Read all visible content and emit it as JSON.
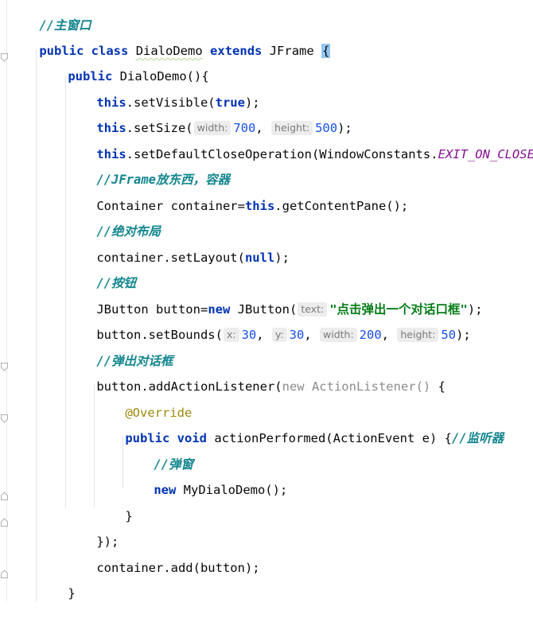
{
  "code": {
    "l1": {
      "comment": "//主窗口"
    },
    "l2": {
      "kw_public": "public",
      "kw_class": "class",
      "class_name": "DialoDemo",
      "kw_extends": "extends",
      "parent": "JFrame",
      "brace": "{"
    },
    "l3": {
      "kw_public": "public",
      "ctor": "DialoDemo(){"
    },
    "l4": {
      "kw_this": "this",
      "call": ".setVisible(",
      "kw_true": "true",
      "end": ");"
    },
    "l5": {
      "kw_this": "this",
      "call": ".setSize(",
      "hint_width": "width:",
      "width": "700",
      "comma": ",",
      "hint_height": "height:",
      "height": "500",
      "end": ");"
    },
    "l6": {
      "kw_this": "this",
      "call": ".setDefaultCloseOperation(WindowConstants.",
      "constant": "EXIT_ON_CLOSE",
      "end": ");"
    },
    "l7": {
      "comment": "//JFrame放东西，容器"
    },
    "l8": {
      "pre": "Container container=",
      "kw_this": "this",
      "post": ".getContentPane();"
    },
    "l9": {
      "comment": "//绝对布局"
    },
    "l10": {
      "pre": "container.setLayout(",
      "kw_null": "null",
      "end": ");"
    },
    "l11": {
      "comment": "//按钮"
    },
    "l12": {
      "pre": "JButton button=",
      "kw_new": "new",
      "call": " JButton(",
      "hint_text": "text:",
      "string": "\"点击弹出一个对话口框\"",
      "end": ");"
    },
    "l13": {
      "call": "button.setBounds(",
      "hint_x": "x:",
      "x": "30",
      "hint_y": "y:",
      "y": "30",
      "hint_width": "width:",
      "width": "200",
      "hint_height": "height:",
      "height": "50",
      "comma": ",",
      "end": ");"
    },
    "l14": {
      "comment": "//弹出对话框"
    },
    "l15": {
      "pre": "button.addActionListener(",
      "kw_new": "new",
      "anon": " ActionListener()",
      "end": " {"
    },
    "l16": {
      "annotation": "@Override"
    },
    "l17": {
      "kw_public": "public",
      "kw_void": "void",
      "method": " actionPerformed(ActionEvent e) {",
      "comment": "//监听器"
    },
    "l18": {
      "comment": "//弹窗"
    },
    "l19": {
      "kw_new": "new",
      "post": " MyDialoDemo();"
    },
    "l20": {
      "text": "}"
    },
    "l21": {
      "text": "});"
    },
    "l22": {
      "text": "container.add(button);"
    },
    "l23": {
      "text": "}"
    }
  }
}
